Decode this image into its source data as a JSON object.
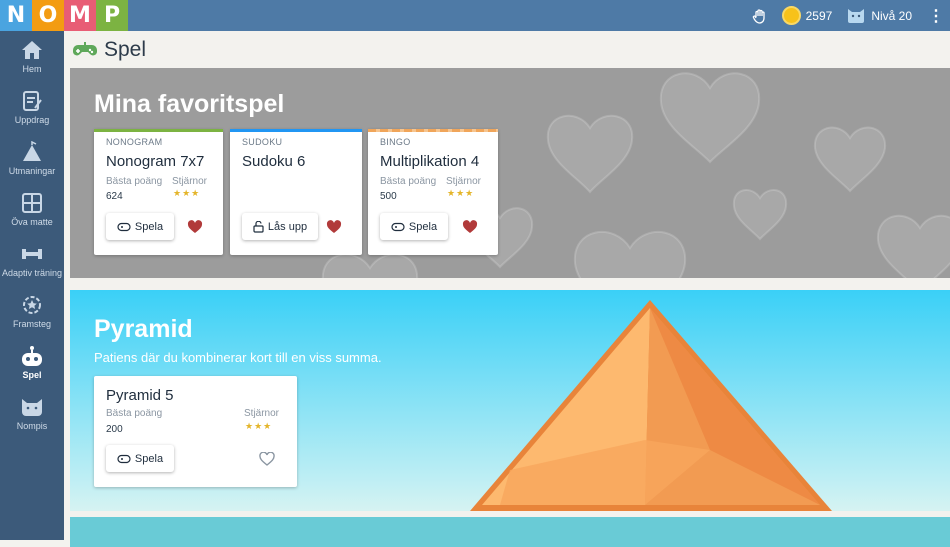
{
  "topbar": {
    "logo_letters": [
      "N",
      "O",
      "M",
      "P"
    ],
    "logo_colors": [
      "#4aa4e0",
      "#f39c12",
      "#e85d75",
      "#7cb342"
    ],
    "coins": "2597",
    "level": "Nivå 20"
  },
  "sidebar": {
    "items": [
      {
        "label": "Hem",
        "icon": "home-icon"
      },
      {
        "label": "Uppdrag",
        "icon": "task-icon"
      },
      {
        "label": "Utmaningar",
        "icon": "tent-icon"
      },
      {
        "label": "Öva matte",
        "icon": "calculator-icon"
      },
      {
        "label": "Adaptiv träning",
        "icon": "dumbbell-icon"
      },
      {
        "label": "Framsteg",
        "icon": "progress-icon"
      },
      {
        "label": "Spel",
        "icon": "robot-icon"
      },
      {
        "label": "Nompis",
        "icon": "cat-icon"
      }
    ]
  },
  "page": {
    "title": "Spel"
  },
  "favorites": {
    "heading": "Mina favoritspel",
    "cards": [
      {
        "category": "NONOGRAM",
        "name": "Nonogram 7x7",
        "best_label": "Bästa poäng",
        "stars_label": "Stjärnor",
        "score": "624",
        "stars": 3,
        "button": "Spela",
        "strip": "#7cb342",
        "favorite": true
      },
      {
        "category": "SUDOKU",
        "name": "Sudoku 6",
        "button": "Lås upp",
        "strip": "#2196f3",
        "favorite": true
      },
      {
        "category": "BINGO",
        "name": "Multiplikation 4",
        "best_label": "Bästa poäng",
        "stars_label": "Stjärnor",
        "score": "500",
        "stars": 3,
        "button": "Spela",
        "strip": "#f0a55a",
        "favorite": true
      }
    ]
  },
  "pyramid": {
    "heading": "Pyramid",
    "description": "Patiens där du kombinerar kort till en viss summa.",
    "card": {
      "name": "Pyramid 5",
      "best_label": "Bästa poäng",
      "stars_label": "Stjärnor",
      "score": "200",
      "stars": 3,
      "button": "Spela",
      "favorite": false
    }
  }
}
